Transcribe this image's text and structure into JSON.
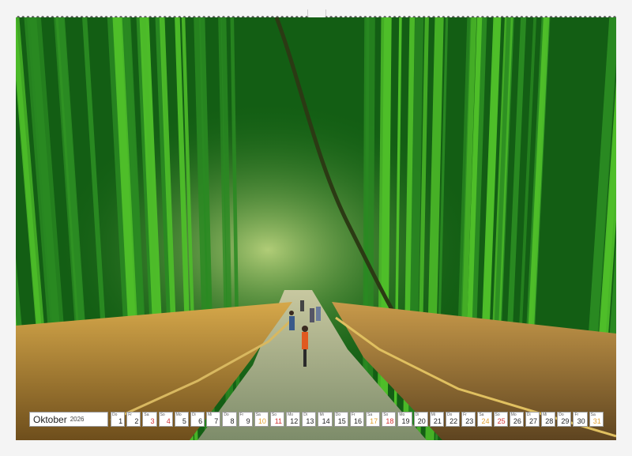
{
  "calendar": {
    "month": "Oktober",
    "year": "2026",
    "days": [
      {
        "num": "1",
        "dow": "Do",
        "type": "weekday"
      },
      {
        "num": "2",
        "dow": "Fr",
        "type": "weekday"
      },
      {
        "num": "3",
        "dow": "Sa",
        "type": "sun"
      },
      {
        "num": "4",
        "dow": "So",
        "type": "sun"
      },
      {
        "num": "5",
        "dow": "Mo",
        "type": "weekday"
      },
      {
        "num": "6",
        "dow": "Di",
        "type": "weekday"
      },
      {
        "num": "7",
        "dow": "Mi",
        "type": "weekday"
      },
      {
        "num": "8",
        "dow": "Do",
        "type": "weekday"
      },
      {
        "num": "9",
        "dow": "Fr",
        "type": "weekday"
      },
      {
        "num": "10",
        "dow": "Sa",
        "type": "sat"
      },
      {
        "num": "11",
        "dow": "So",
        "type": "sun"
      },
      {
        "num": "12",
        "dow": "Mo",
        "type": "weekday"
      },
      {
        "num": "13",
        "dow": "Di",
        "type": "weekday"
      },
      {
        "num": "14",
        "dow": "Mi",
        "type": "weekday"
      },
      {
        "num": "15",
        "dow": "Do",
        "type": "weekday"
      },
      {
        "num": "16",
        "dow": "Fr",
        "type": "weekday"
      },
      {
        "num": "17",
        "dow": "Sa",
        "type": "sat"
      },
      {
        "num": "18",
        "dow": "So",
        "type": "sun"
      },
      {
        "num": "19",
        "dow": "Mo",
        "type": "weekday"
      },
      {
        "num": "20",
        "dow": "Di",
        "type": "weekday"
      },
      {
        "num": "21",
        "dow": "Mi",
        "type": "weekday"
      },
      {
        "num": "22",
        "dow": "Do",
        "type": "weekday"
      },
      {
        "num": "23",
        "dow": "Fr",
        "type": "weekday"
      },
      {
        "num": "24",
        "dow": "Sa",
        "type": "sat"
      },
      {
        "num": "25",
        "dow": "So",
        "type": "sun"
      },
      {
        "num": "26",
        "dow": "Mo",
        "type": "weekday"
      },
      {
        "num": "27",
        "dow": "Di",
        "type": "weekday"
      },
      {
        "num": "28",
        "dow": "Mi",
        "type": "weekday"
      },
      {
        "num": "29",
        "dow": "Do",
        "type": "weekday"
      },
      {
        "num": "30",
        "dow": "Fr",
        "type": "weekday"
      },
      {
        "num": "31",
        "dow": "Sa",
        "type": "sat"
      }
    ]
  },
  "colors": {
    "sat": "#e0a030",
    "sun": "#d03030",
    "bamboo_light": "#4fbf2a",
    "bamboo_dark": "#0c4a10",
    "grass": "#b58a3a",
    "path": "#8a9a7a"
  }
}
